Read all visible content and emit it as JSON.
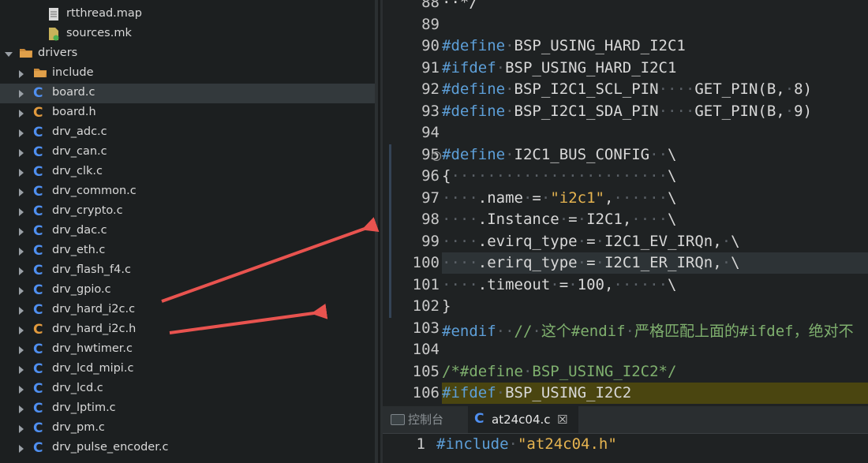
{
  "tree": [
    {
      "name": "rtthread.map",
      "depth": 2,
      "kind": "file-doc",
      "expander": "none"
    },
    {
      "name": "sources.mk",
      "depth": 2,
      "kind": "file-mk",
      "expander": "none"
    },
    {
      "name": "drivers",
      "depth": 0,
      "kind": "folder",
      "expander": "open"
    },
    {
      "name": "include",
      "depth": 1,
      "kind": "folder",
      "expander": "closed"
    },
    {
      "name": "board.c",
      "depth": 1,
      "kind": "c",
      "expander": "closed",
      "selected": true
    },
    {
      "name": "board.h",
      "depth": 1,
      "kind": "h",
      "expander": "closed"
    },
    {
      "name": "drv_adc.c",
      "depth": 1,
      "kind": "c",
      "expander": "closed"
    },
    {
      "name": "drv_can.c",
      "depth": 1,
      "kind": "c",
      "expander": "closed"
    },
    {
      "name": "drv_clk.c",
      "depth": 1,
      "kind": "c",
      "expander": "closed"
    },
    {
      "name": "drv_common.c",
      "depth": 1,
      "kind": "c",
      "expander": "closed"
    },
    {
      "name": "drv_crypto.c",
      "depth": 1,
      "kind": "c",
      "expander": "closed"
    },
    {
      "name": "drv_dac.c",
      "depth": 1,
      "kind": "c",
      "expander": "closed"
    },
    {
      "name": "drv_eth.c",
      "depth": 1,
      "kind": "c",
      "expander": "closed"
    },
    {
      "name": "drv_flash_f4.c",
      "depth": 1,
      "kind": "c",
      "expander": "closed"
    },
    {
      "name": "drv_gpio.c",
      "depth": 1,
      "kind": "c",
      "expander": "closed"
    },
    {
      "name": "drv_hard_i2c.c",
      "depth": 1,
      "kind": "c",
      "expander": "closed"
    },
    {
      "name": "drv_hard_i2c.h",
      "depth": 1,
      "kind": "h",
      "expander": "closed"
    },
    {
      "name": "drv_hwtimer.c",
      "depth": 1,
      "kind": "c",
      "expander": "closed"
    },
    {
      "name": "drv_lcd_mipi.c",
      "depth": 1,
      "kind": "c",
      "expander": "closed"
    },
    {
      "name": "drv_lcd.c",
      "depth": 1,
      "kind": "c",
      "expander": "closed"
    },
    {
      "name": "drv_lptim.c",
      "depth": 1,
      "kind": "c",
      "expander": "closed"
    },
    {
      "name": "drv_pm.c",
      "depth": 1,
      "kind": "c",
      "expander": "closed"
    },
    {
      "name": "drv_pulse_encoder.c",
      "depth": 1,
      "kind": "c",
      "expander": "closed"
    }
  ],
  "editor": {
    "lines": [
      {
        "n": "88",
        "parts": [
          [
            "tx",
            "··*/"
          ]
        ]
      },
      {
        "n": "89",
        "parts": []
      },
      {
        "n": "90",
        "parts": [
          [
            "kw",
            "#define"
          ],
          [
            "dot",
            "·"
          ],
          [
            "tx",
            "BSP_USING_HARD_I2C1"
          ]
        ]
      },
      {
        "n": "91",
        "parts": [
          [
            "kw",
            "#ifdef"
          ],
          [
            "dot",
            "·"
          ],
          [
            "tx",
            "BSP_USING_HARD_I2C1"
          ]
        ]
      },
      {
        "n": "92",
        "parts": [
          [
            "kw",
            "#define"
          ],
          [
            "dot",
            "·"
          ],
          [
            "tx",
            "BSP_I2C1_SCL_PIN"
          ],
          [
            "dot",
            "····"
          ],
          [
            "tx",
            "GET_PIN(B,"
          ],
          [
            "dot",
            "·"
          ],
          [
            "tx",
            "8)"
          ]
        ]
      },
      {
        "n": "93",
        "parts": [
          [
            "kw",
            "#define"
          ],
          [
            "dot",
            "·"
          ],
          [
            "tx",
            "BSP_I2C1_SDA_PIN"
          ],
          [
            "dot",
            "····"
          ],
          [
            "tx",
            "GET_PIN(B,"
          ],
          [
            "dot",
            "·"
          ],
          [
            "tx",
            "9)"
          ]
        ]
      },
      {
        "n": "94",
        "parts": []
      },
      {
        "n": "95",
        "parts": [
          [
            "kw",
            "#define"
          ],
          [
            "dot",
            "·"
          ],
          [
            "tx",
            "I2C1_BUS_CONFIG"
          ],
          [
            "dot",
            "··"
          ],
          [
            "tx",
            "\\"
          ]
        ]
      },
      {
        "n": "96",
        "parts": [
          [
            "tx",
            "{"
          ],
          [
            "dot",
            "························"
          ],
          [
            "tx",
            "\\"
          ]
        ]
      },
      {
        "n": "97",
        "parts": [
          [
            "dot",
            "····"
          ],
          [
            "tx",
            ".name"
          ],
          [
            "dot",
            "·"
          ],
          [
            "tx",
            "="
          ],
          [
            "dot",
            "·"
          ],
          [
            "str",
            "\"i2c1\""
          ],
          [
            "tx",
            ","
          ],
          [
            "dot",
            "······"
          ],
          [
            "tx",
            "\\"
          ]
        ]
      },
      {
        "n": "98",
        "parts": [
          [
            "dot",
            "····"
          ],
          [
            "tx",
            ".Instance"
          ],
          [
            "dot",
            "·"
          ],
          [
            "tx",
            "="
          ],
          [
            "dot",
            "·"
          ],
          [
            "tx",
            "I2C1,"
          ],
          [
            "dot",
            "····"
          ],
          [
            "tx",
            "\\"
          ]
        ]
      },
      {
        "n": "99",
        "parts": [
          [
            "dot",
            "····"
          ],
          [
            "tx",
            ".evirq_type"
          ],
          [
            "dot",
            "·"
          ],
          [
            "tx",
            "="
          ],
          [
            "dot",
            "·"
          ],
          [
            "tx",
            "I2C1_EV_IRQn,"
          ],
          [
            "dot",
            "·"
          ],
          [
            "tx",
            "\\"
          ]
        ]
      },
      {
        "n": "100",
        "parts": [
          [
            "dot",
            "····"
          ],
          [
            "tx",
            ".erirq_type"
          ],
          [
            "dot",
            "·"
          ],
          [
            "tx",
            "="
          ],
          [
            "dot",
            "·"
          ],
          [
            "tx",
            "I2C1_ER_IRQn,"
          ],
          [
            "dot",
            "·"
          ],
          [
            "tx",
            "\\"
          ]
        ]
      },
      {
        "n": "101",
        "parts": [
          [
            "dot",
            "····"
          ],
          [
            "tx",
            ".timeout"
          ],
          [
            "dot",
            "·"
          ],
          [
            "tx",
            "="
          ],
          [
            "dot",
            "·"
          ],
          [
            "tx",
            "100,"
          ],
          [
            "dot",
            "······"
          ],
          [
            "tx",
            "\\"
          ]
        ]
      },
      {
        "n": "102",
        "parts": [
          [
            "tx",
            "}"
          ]
        ]
      },
      {
        "n": "103",
        "parts": [
          [
            "kw",
            "#endif"
          ],
          [
            "dot",
            "··"
          ],
          [
            "cm",
            "//"
          ],
          [
            "dot",
            "·"
          ],
          [
            "cm",
            "这个#endif"
          ],
          [
            "dot",
            "·"
          ],
          [
            "cm",
            "严格匹配上面的#ifdef，绝对不"
          ]
        ]
      },
      {
        "n": "104",
        "parts": []
      },
      {
        "n": "105",
        "parts": [
          [
            "cm",
            "/*#define"
          ],
          [
            "dot",
            "·"
          ],
          [
            "cm",
            "BSP_USING_I2C2*/"
          ]
        ]
      },
      {
        "n": "106",
        "parts": [
          [
            "kw",
            "#ifdef"
          ],
          [
            "dot",
            "·"
          ],
          [
            "tx",
            "BSP_USING_I2C2"
          ]
        ]
      }
    ]
  },
  "bottom": {
    "tabs": [
      {
        "label": "控制台",
        "icon": "console-icon"
      },
      {
        "label": "at24c04.c",
        "icon": "c-file-icon",
        "close": "☒"
      }
    ],
    "code_lines": [
      {
        "n": "1",
        "parts": [
          [
            "kw",
            "#include"
          ],
          [
            "dot",
            "·"
          ],
          [
            "str",
            "\"at24c04.h\""
          ]
        ]
      }
    ]
  },
  "colors": {
    "accent_c": "#4f8ff0",
    "accent_h": "#e29a3d",
    "folder": "#e0a04a",
    "arrow": "#e8534f"
  }
}
